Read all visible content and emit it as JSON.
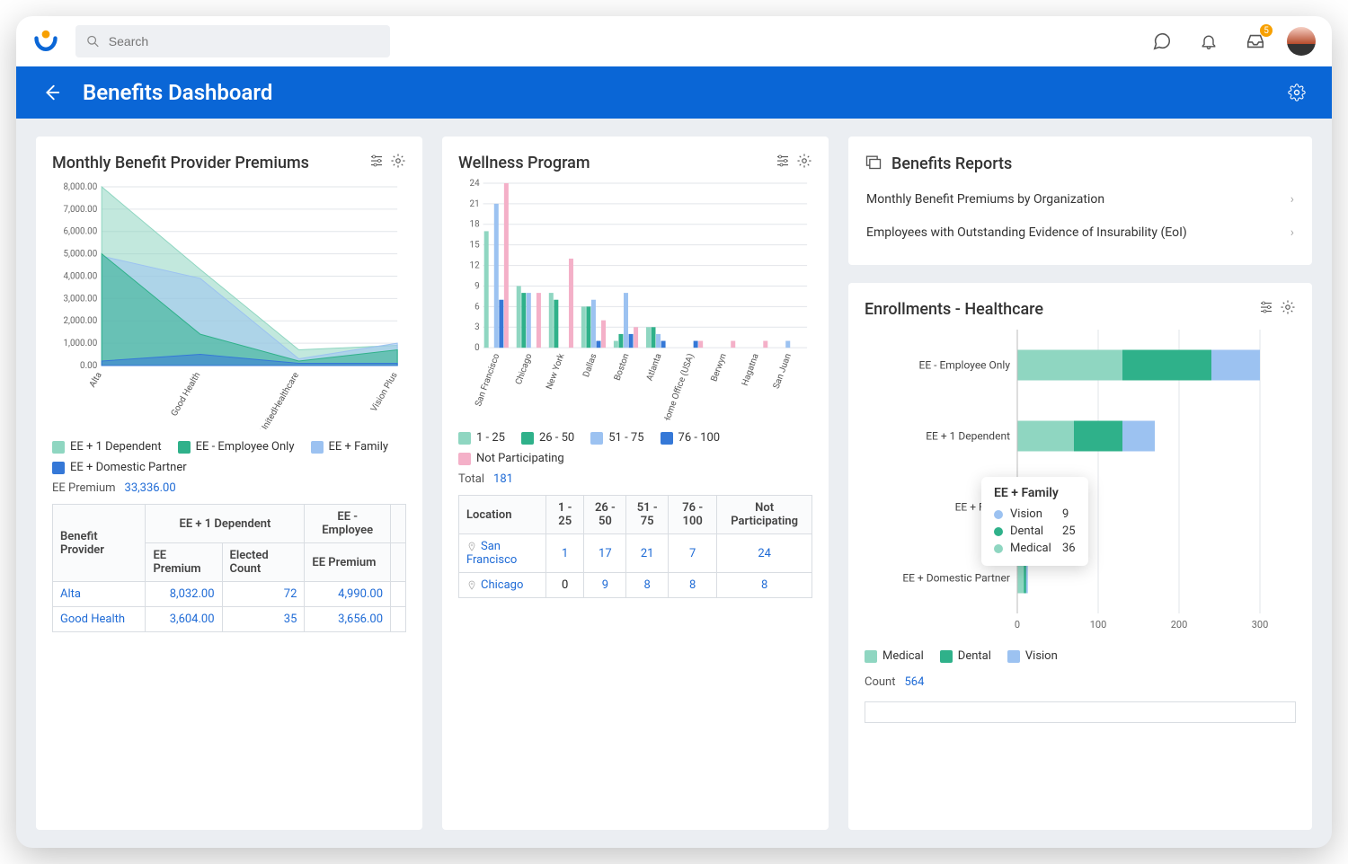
{
  "colors": {
    "medical": "#8fd6c1",
    "dental": "#2fb18a",
    "vision": "#9cc2f1",
    "darkblue": "#3578d7",
    "pink": "#f4b0c8"
  },
  "topbar": {
    "search_placeholder": "Search",
    "inbox_badge": "5"
  },
  "banner": {
    "title": "Benefits Dashboard"
  },
  "premiums": {
    "title": "Monthly Benefit Provider Premiums",
    "legend": [
      {
        "label": "EE + 1 Dependent",
        "color": "#8fd6c1"
      },
      {
        "label": "EE - Employee Only",
        "color": "#2fb18a"
      },
      {
        "label": "EE + Family",
        "color": "#9cc2f1"
      },
      {
        "label": "EE + Domestic Partner",
        "color": "#3578d7"
      }
    ],
    "total_label": "EE Premium",
    "total_value": "33,336.00",
    "table": {
      "group_hdr1": "EE + 1 Dependent",
      "group_hdr2": "EE - Employee",
      "col_provider": "Benefit Provider",
      "col_premium": "EE Premium",
      "col_elected": "Elected Count",
      "rows": [
        {
          "provider": "Alta",
          "p1": "8,032.00",
          "cnt": "72",
          "p2": "4,990.00"
        },
        {
          "provider": "Good Health",
          "p1": "3,604.00",
          "cnt": "35",
          "p2": "3,656.00"
        }
      ]
    }
  },
  "wellness": {
    "title": "Wellness Program",
    "legend": [
      {
        "label": "1 - 25",
        "color": "#8fd6c1"
      },
      {
        "label": "26 - 50",
        "color": "#2fb18a"
      },
      {
        "label": "51 - 75",
        "color": "#9cc2f1"
      },
      {
        "label": "76 - 100",
        "color": "#3578d7"
      },
      {
        "label": "Not Participating",
        "color": "#f4b0c8"
      }
    ],
    "total_label": "Total",
    "total_value": "181",
    "table": {
      "cols": [
        "Location",
        "1 - 25",
        "26 - 50",
        "51 - 75",
        "76 - 100",
        "Not Participating"
      ],
      "rows": [
        {
          "loc": "San Francisco",
          "v": [
            "1",
            "17",
            "21",
            "7",
            "24"
          ]
        },
        {
          "loc": "Chicago",
          "v": [
            "0",
            "9",
            "8",
            "8",
            "8"
          ]
        }
      ]
    }
  },
  "reports": {
    "title": "Benefits Reports",
    "items": [
      "Monthly Benefit Premiums by Organization",
      "Employees with Outstanding Evidence of Insurability (EoI)"
    ]
  },
  "enroll": {
    "title": "Enrollments - Healthcare",
    "legend": [
      {
        "label": "Medical",
        "color": "#8fd6c1"
      },
      {
        "label": "Dental",
        "color": "#2fb18a"
      },
      {
        "label": "Vision",
        "color": "#9cc2f1"
      }
    ],
    "count_label": "Count",
    "count_value": "564",
    "tooltip": {
      "title": "EE + Family",
      "rows": [
        {
          "label": "Vision",
          "val": "9",
          "color": "#9cc2f1"
        },
        {
          "label": "Dental",
          "val": "25",
          "color": "#2fb18a"
        },
        {
          "label": "Medical",
          "val": "36",
          "color": "#8fd6c1"
        }
      ]
    }
  },
  "chart_data": [
    {
      "id": "premiums_area",
      "type": "area",
      "title": "Monthly Benefit Provider Premiums",
      "categories": [
        "Alta",
        "Good Health",
        "UnitedHealthcare",
        "Vision Plus"
      ],
      "ylim": [
        0,
        8000
      ],
      "yticks": [
        "0.00",
        "1,000.00",
        "2,000.00",
        "3,000.00",
        "4,000.00",
        "5,000.00",
        "6,000.00",
        "7,000.00",
        "8,000.00"
      ],
      "series": [
        {
          "name": "EE + 1 Dependent",
          "color": "#8fd6c1",
          "values": [
            8000,
            4300,
            700,
            900
          ]
        },
        {
          "name": "EE - Employee Only",
          "color": "#2fb18a",
          "values": [
            5000,
            1400,
            200,
            700
          ]
        },
        {
          "name": "EE + Family",
          "color": "#9cc2f1",
          "values": [
            4900,
            3900,
            300,
            1000
          ]
        },
        {
          "name": "EE + Domestic Partner",
          "color": "#3578d7",
          "values": [
            200,
            500,
            100,
            100
          ]
        }
      ]
    },
    {
      "id": "wellness_bar",
      "type": "bar",
      "title": "Wellness Program",
      "categories": [
        "San Francisco",
        "Chicago",
        "New York",
        "Dallas",
        "Boston",
        "Atlanta",
        "Home Office (USA)",
        "Berwyn",
        "Hagatna",
        "San Juan"
      ],
      "ylim": [
        0,
        24
      ],
      "yticks": [
        0,
        3,
        6,
        9,
        12,
        15,
        18,
        21,
        24
      ],
      "series": [
        {
          "name": "1 - 25",
          "color": "#8fd6c1",
          "values": [
            17,
            9,
            8,
            6,
            1,
            3,
            0,
            0,
            0,
            0
          ]
        },
        {
          "name": "26 - 50",
          "color": "#2fb18a",
          "values": [
            0,
            8,
            7,
            6,
            2,
            3,
            0,
            0,
            0,
            0
          ]
        },
        {
          "name": "51 - 75",
          "color": "#9cc2f1",
          "values": [
            21,
            8,
            0,
            7,
            8,
            2,
            0,
            0,
            0,
            1
          ]
        },
        {
          "name": "76 - 100",
          "color": "#3578d7",
          "values": [
            7,
            0,
            0,
            1,
            2,
            1,
            1,
            0,
            0,
            0
          ]
        },
        {
          "name": "Not Participating",
          "color": "#f4b0c8",
          "values": [
            24,
            8,
            13,
            4,
            3,
            0,
            1,
            1,
            1,
            0
          ]
        }
      ]
    },
    {
      "id": "enroll_stacked",
      "type": "bar",
      "orientation": "horizontal",
      "stacked": true,
      "title": "Enrollments - Healthcare",
      "categories": [
        "EE - Employee Only",
        "EE + 1 Dependent",
        "EE + Family",
        "EE + Domestic Partner"
      ],
      "xlim": [
        0,
        300
      ],
      "xticks": [
        0,
        100,
        200,
        300
      ],
      "series": [
        {
          "name": "Medical",
          "color": "#8fd6c1",
          "values": [
            130,
            70,
            36,
            8
          ]
        },
        {
          "name": "Dental",
          "color": "#2fb18a",
          "values": [
            110,
            60,
            25,
            3
          ]
        },
        {
          "name": "Vision",
          "color": "#9cc2f1",
          "values": [
            60,
            40,
            9,
            2
          ]
        }
      ]
    }
  ]
}
